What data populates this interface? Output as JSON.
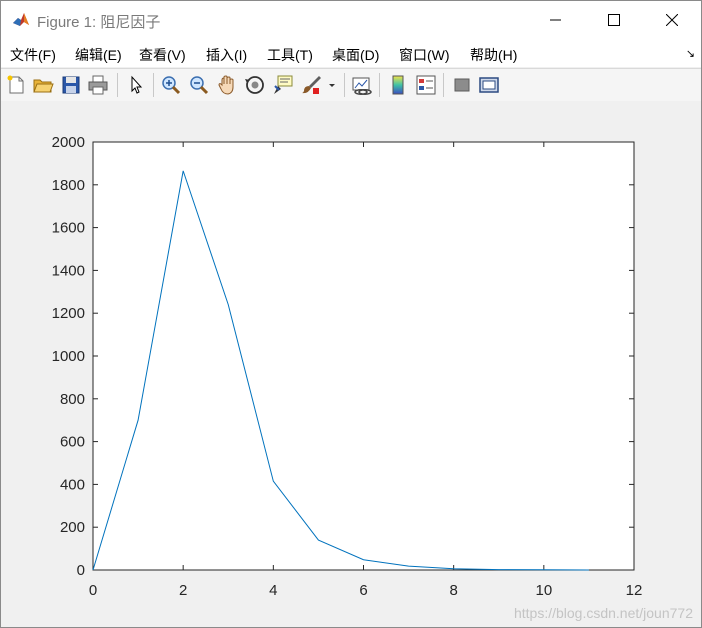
{
  "window": {
    "title": "Figure 1: 阻尼因子"
  },
  "menu": {
    "items": [
      {
        "label": "文件(F)"
      },
      {
        "label": "编辑(E)"
      },
      {
        "label": "查看(V)"
      },
      {
        "label": "插入(I)"
      },
      {
        "label": "工具(T)"
      },
      {
        "label": "桌面(D)"
      },
      {
        "label": "窗口(W)"
      },
      {
        "label": "帮助(H)"
      }
    ],
    "dock_glyph": "↘"
  },
  "toolbar": {
    "icons": [
      "new-figure-icon",
      "open-file-icon",
      "save-icon",
      "print-icon",
      "edit-plot-icon",
      "zoom-in-icon",
      "zoom-out-icon",
      "pan-icon",
      "rotate-3d-icon",
      "data-cursor-icon",
      "brush-icon",
      "link-plot-icon",
      "colorbar-icon",
      "legend-icon",
      "hide-plot-tools-icon",
      "show-plot-tools-icon"
    ]
  },
  "chart_data": {
    "type": "line",
    "x": [
      0,
      1,
      2,
      3,
      4,
      5,
      6,
      7,
      8,
      9,
      10,
      11
    ],
    "series": [
      {
        "values": [
          0,
          700,
          1865,
          1240,
          415,
          140,
          48,
          18,
          6,
          2,
          1,
          0
        ],
        "color": "#0072bd"
      }
    ],
    "xlim": [
      0,
      12
    ],
    "ylim": [
      0,
      2000
    ],
    "xticks": [
      "0",
      "2",
      "4",
      "6",
      "8",
      "10",
      "12"
    ],
    "yticks": [
      "0",
      "200",
      "400",
      "600",
      "800",
      "1000",
      "1200",
      "1400",
      "1600",
      "1800",
      "2000"
    ],
    "grid": false,
    "title": "",
    "xlabel": "",
    "ylabel": ""
  },
  "watermark": "https://blog.csdn.net/joun772"
}
